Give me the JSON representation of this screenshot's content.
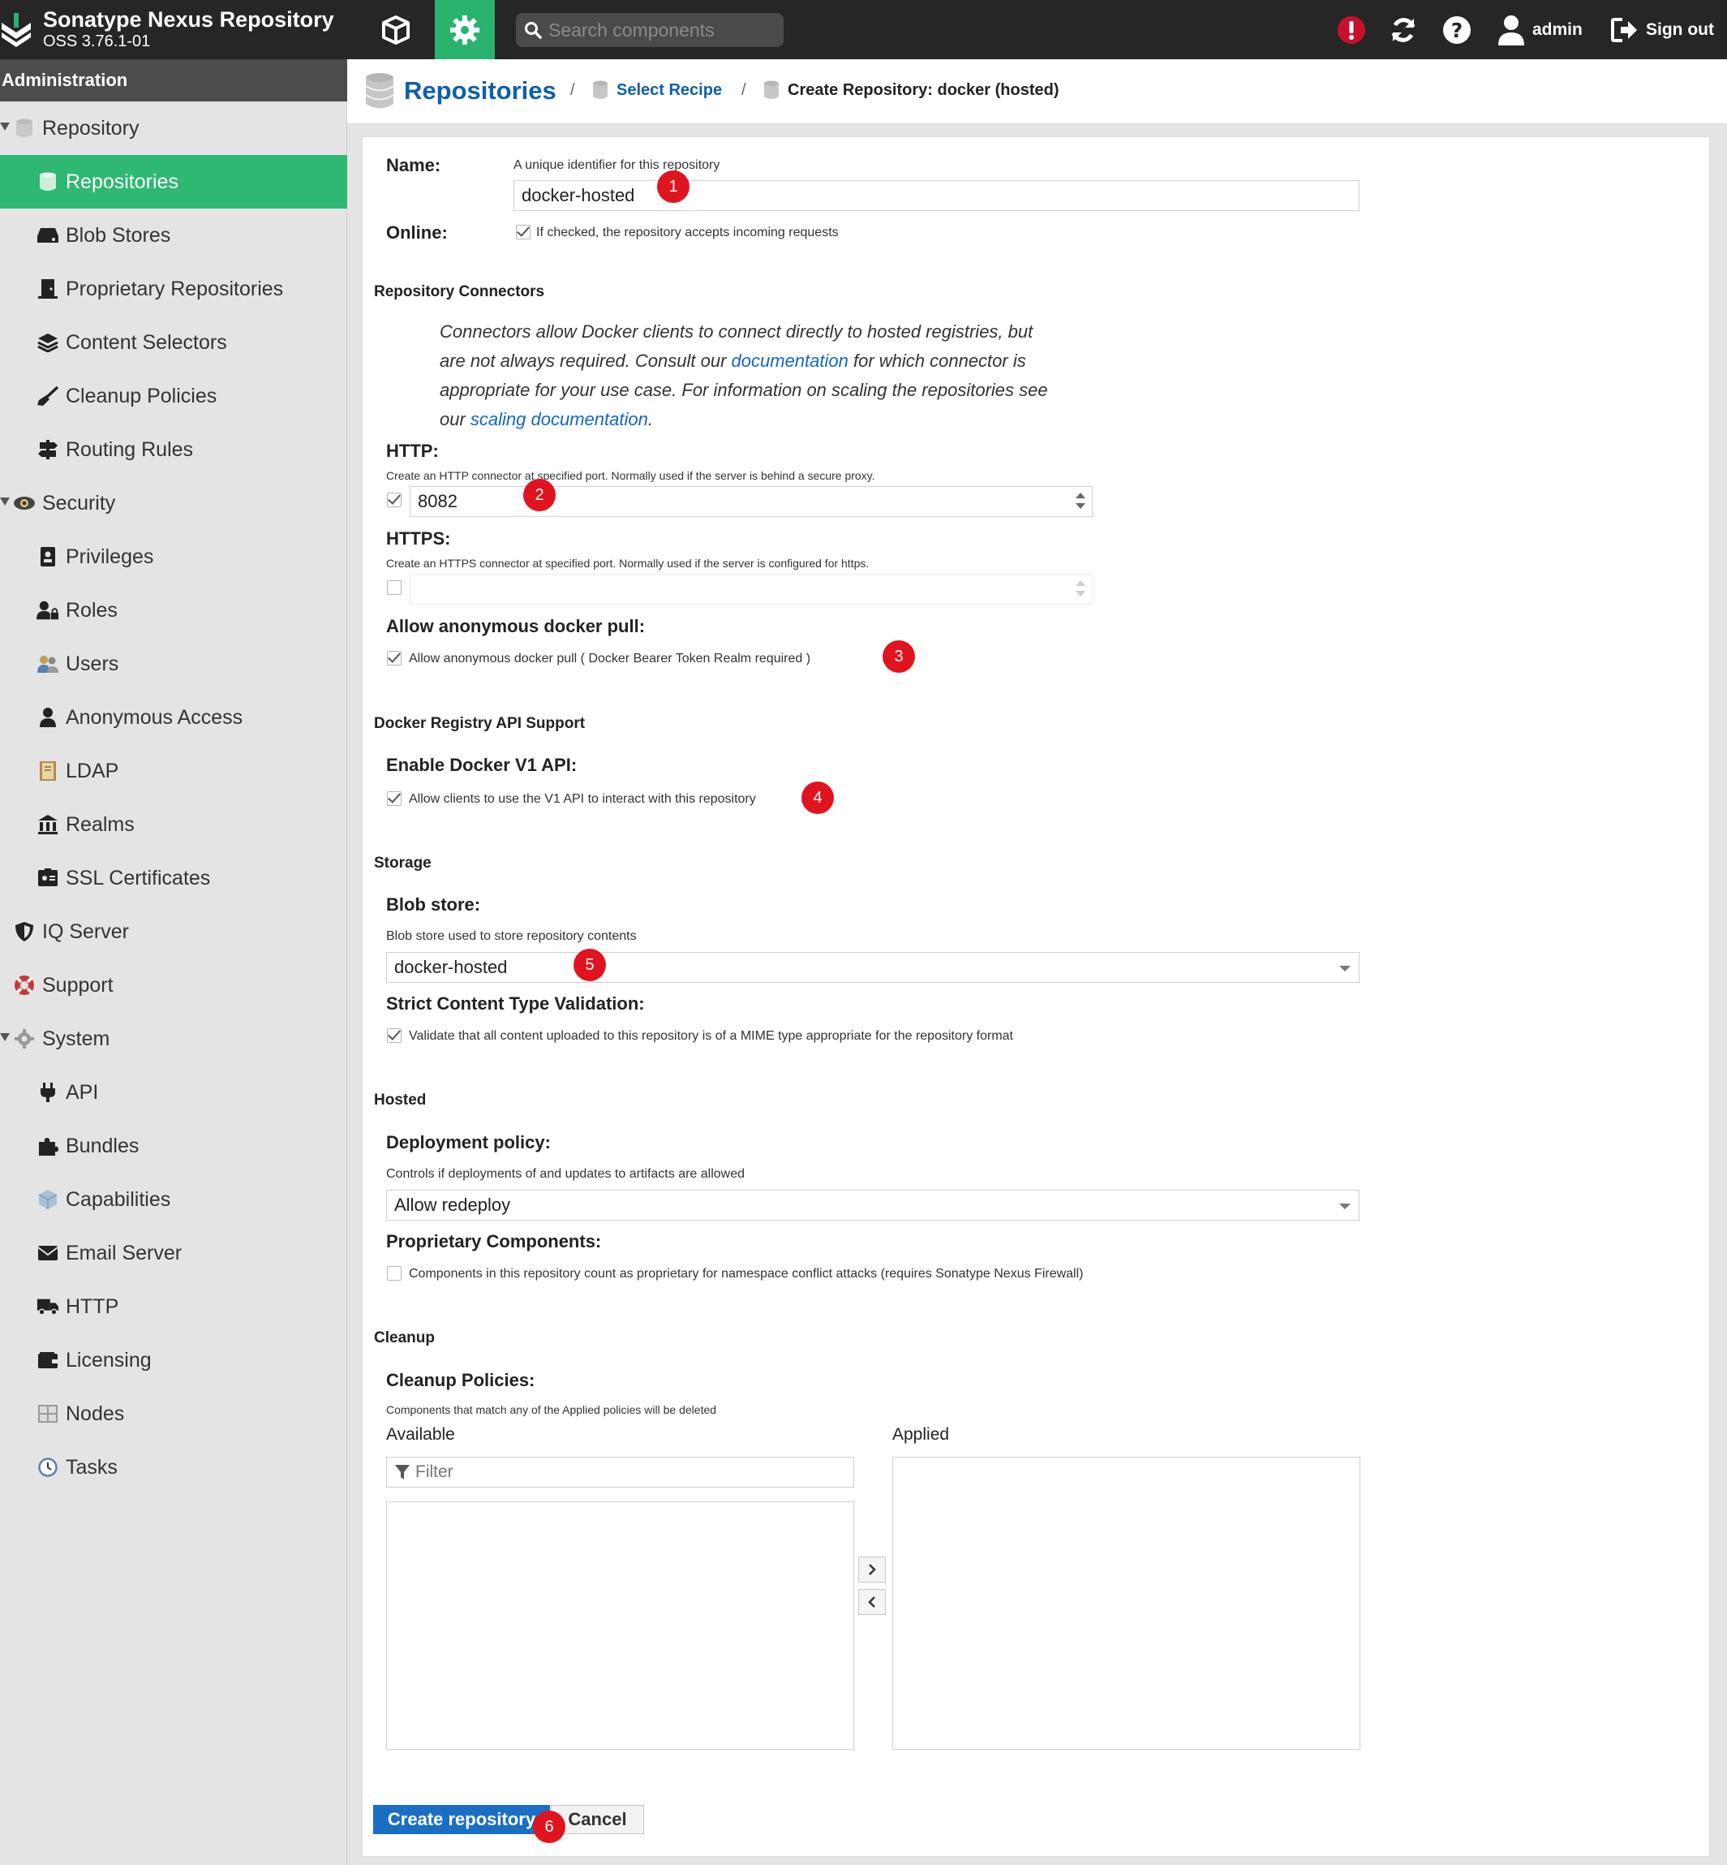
{
  "header": {
    "app_title": "Sonatype Nexus Repository",
    "version": "OSS 3.76.1-01",
    "search_placeholder": "Search components",
    "user_label": "admin",
    "signout_label": "Sign out",
    "accent_color": "#29b36e"
  },
  "sidebar": {
    "heading": "Administration",
    "items": [
      {
        "label": "Repository",
        "icon": "database-icon",
        "level": 1,
        "caret": true
      },
      {
        "label": "Repositories",
        "icon": "database-icon",
        "level": 2,
        "active": true
      },
      {
        "label": "Blob Stores",
        "icon": "hdd-icon",
        "level": 2
      },
      {
        "label": "Proprietary Repositories",
        "icon": "door-icon",
        "level": 2
      },
      {
        "label": "Content Selectors",
        "icon": "layers-icon",
        "level": 2
      },
      {
        "label": "Cleanup Policies",
        "icon": "broom-icon",
        "level": 2
      },
      {
        "label": "Routing Rules",
        "icon": "signpost-icon",
        "level": 2
      },
      {
        "label": "Security",
        "icon": "eye-icon",
        "level": 1,
        "caret": true
      },
      {
        "label": "Privileges",
        "icon": "id-badge-icon",
        "level": 2
      },
      {
        "label": "Roles",
        "icon": "user-lock-icon",
        "level": 2
      },
      {
        "label": "Users",
        "icon": "users-icon",
        "level": 2
      },
      {
        "label": "Anonymous Access",
        "icon": "user-icon",
        "level": 2
      },
      {
        "label": "LDAP",
        "icon": "book-icon",
        "level": 2
      },
      {
        "label": "Realms",
        "icon": "building-icon",
        "level": 2
      },
      {
        "label": "SSL Certificates",
        "icon": "certificate-icon",
        "level": 2
      },
      {
        "label": "IQ Server",
        "icon": "shield-icon",
        "level": 1
      },
      {
        "label": "Support",
        "icon": "lifebuoy-icon",
        "level": 1
      },
      {
        "label": "System",
        "icon": "gear-icon",
        "level": 1,
        "caret": true
      },
      {
        "label": "API",
        "icon": "plug-icon",
        "level": 2
      },
      {
        "label": "Bundles",
        "icon": "puzzle-icon",
        "level": 2
      },
      {
        "label": "Capabilities",
        "icon": "cube-icon",
        "level": 2
      },
      {
        "label": "Email Server",
        "icon": "envelope-icon",
        "level": 2
      },
      {
        "label": "HTTP",
        "icon": "truck-icon",
        "level": 2
      },
      {
        "label": "Licensing",
        "icon": "wallet-icon",
        "level": 2
      },
      {
        "label": "Nodes",
        "icon": "server-icon",
        "level": 2
      },
      {
        "label": "Tasks",
        "icon": "clock-icon",
        "level": 2
      }
    ]
  },
  "breadcrumb": {
    "root": "Repositories",
    "step1": "Select Recipe",
    "step2": "Create Repository: docker (hosted)",
    "separator": "/"
  },
  "form": {
    "name_label": "Name:",
    "name_help": "A unique identifier for this repository",
    "name_value": "docker-hosted",
    "online_label": "Online:",
    "online_help": "If checked, the repository accepts incoming requests",
    "online_checked": true,
    "connectors_section": "Repository Connectors",
    "connectors_desc_1": "Connectors allow Docker clients to connect directly to hosted registries, but are not always required. Consult our ",
    "connectors_link_1": "documentation",
    "connectors_desc_2": " for which connector is appropriate for your use case. For information on scaling the repositories see our ",
    "connectors_link_2": "scaling documentation",
    "connectors_desc_3": ".",
    "http_label": "HTTP:",
    "http_help": "Create an HTTP connector at specified port. Normally used if the server is behind a secure proxy.",
    "http_checked": true,
    "http_port": "8082",
    "https_label": "HTTPS:",
    "https_help": "Create an HTTPS connector at specified port. Normally used if the server is configured for https.",
    "https_checked": false,
    "https_port": "",
    "anon_label": "Allow anonymous docker pull:",
    "anon_help": "Allow anonymous docker pull ( Docker Bearer Token Realm required )",
    "anon_checked": true,
    "api_section": "Docker Registry API Support",
    "v1_label": "Enable Docker V1 API:",
    "v1_help": "Allow clients to use the V1 API to interact with this repository",
    "v1_checked": true,
    "storage_section": "Storage",
    "blob_label": "Blob store:",
    "blob_help": "Blob store used to store repository contents",
    "blob_value": "docker-hosted",
    "strict_label": "Strict Content Type Validation:",
    "strict_help": "Validate that all content uploaded to this repository is of a MIME type appropriate for the repository format",
    "strict_checked": true,
    "hosted_section": "Hosted",
    "deploy_label": "Deployment policy:",
    "deploy_help": "Controls if deployments of and updates to artifacts are allowed",
    "deploy_value": "Allow redeploy",
    "prop_label": "Proprietary Components:",
    "prop_help": "Components in this repository count as proprietary for namespace conflict attacks (requires Sonatype Nexus Firewall)",
    "prop_checked": false,
    "cleanup_section": "Cleanup",
    "cleanup_label": "Cleanup Policies:",
    "cleanup_help": "Components that match any of the Applied policies will be deleted",
    "available_label": "Available",
    "applied_label": "Applied",
    "filter_placeholder": "Filter",
    "create_button": "Create repository",
    "cancel_button": "Cancel"
  },
  "annotations": [
    "1",
    "2",
    "3",
    "4",
    "5",
    "6"
  ]
}
